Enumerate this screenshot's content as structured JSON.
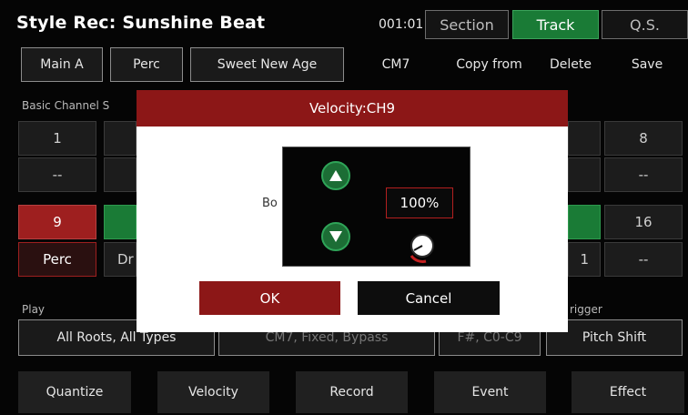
{
  "header": {
    "title": "Style Rec: Sunshine Beat",
    "counter": "001:01",
    "tabs": [
      {
        "label": "Section",
        "active": false
      },
      {
        "label": "Track",
        "active": true
      },
      {
        "label": "Q.S.",
        "active": false
      }
    ]
  },
  "toolbar": {
    "main_a": "Main A",
    "perc": "Perc",
    "sweet_new_age": "Sweet New Age",
    "chord": "CM7",
    "copy_from": "Copy from",
    "delete": "Delete",
    "save": "Save"
  },
  "channels": {
    "label_partial": "Basic Channel S",
    "top_left_num": "1",
    "top_left_val": "--",
    "top_right_num": "8",
    "top_right_val": "--",
    "bottom_left_num": "9",
    "bottom_left_val": "Perc",
    "bottom_right_num": "16",
    "bottom_right_val": "--",
    "partial_dr": "Dr",
    "partial_1": "1"
  },
  "play": {
    "label": "Play",
    "roots_types": "All Roots, All Types",
    "chord_mode": "CM7, Fixed, Bypass",
    "range": "F#, C0-C9",
    "trigger_label": "rigger",
    "pitch_shift": "Pitch Shift"
  },
  "bottom_bar": [
    "Quantize",
    "Velocity",
    "Record",
    "Event",
    "Effect"
  ],
  "dialog": {
    "title": "Velocity:CH9",
    "partial_label": "Bo",
    "value": "100%",
    "ok": "OK",
    "cancel": "Cancel"
  },
  "colors": {
    "accent_green": "#1a7b36",
    "accent_red": "#8c1717",
    "background": "#050505"
  },
  "icons": [
    "arrow-up-icon",
    "arrow-down-icon",
    "knob-icon"
  ]
}
